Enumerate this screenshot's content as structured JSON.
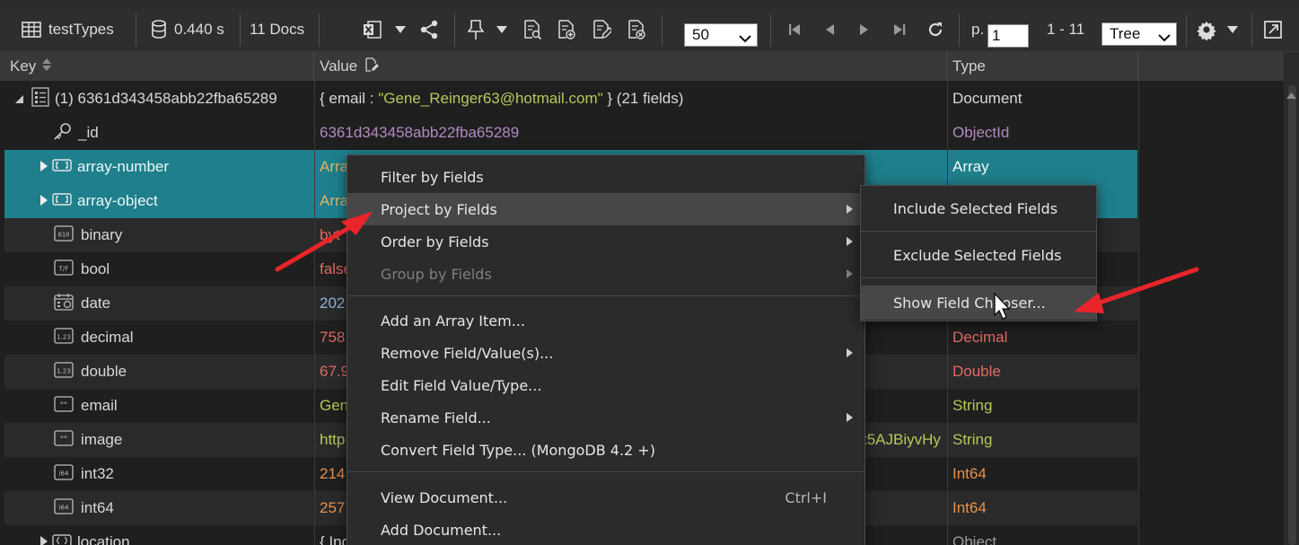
{
  "toolbar": {
    "collection_name": "testTypes",
    "query_time": "0.440 s",
    "doc_count": "11 Docs",
    "page_size": "50",
    "page_label": "p.",
    "page_number": "1",
    "range": "1 - 11",
    "view_mode": "Tree"
  },
  "grid": {
    "columns": [
      "Key",
      "Value",
      "Type"
    ],
    "rows": [
      {
        "key": "(1) 6361d343458abb22fba65289",
        "value_prefix": "{ email : ",
        "value_string": "\"Gene_Reinger63@hotmail.com\"",
        "value_suffix": " } (21 fields)",
        "type": "Document",
        "icon": "document-icon",
        "expander": "expanded"
      },
      {
        "key": "_id",
        "value": "6361d343458abb22fba65289",
        "type": "ObjectId",
        "icon": "key-icon"
      },
      {
        "key": "array-number",
        "value": "Arra",
        "type": "Array",
        "icon": "array-icon",
        "expander": "collapsed",
        "selected": true
      },
      {
        "key": "array-object",
        "value": "Arra",
        "type": "",
        "icon": "array-icon",
        "expander": "collapsed",
        "selected": true
      },
      {
        "key": "binary",
        "value": "byt",
        "type": "",
        "icon": "binary-icon"
      },
      {
        "key": "bool",
        "value": "false",
        "type": "",
        "icon": "bool-icon"
      },
      {
        "key": "date",
        "value": "202",
        "type": "",
        "icon": "calendar-icon"
      },
      {
        "key": "decimal",
        "value": "758",
        "type": "Decimal",
        "icon": "decimal-icon"
      },
      {
        "key": "double",
        "value": "67.9",
        "type": "Double",
        "icon": "double-icon"
      },
      {
        "key": "email",
        "value": "Gen",
        "type": "String",
        "icon": "string-icon"
      },
      {
        "key": "image",
        "value": "http",
        "value_tail": "t5AJBiyvHy",
        "type": "String",
        "icon": "string-icon"
      },
      {
        "key": "int32",
        "value": "214",
        "type": "Int64",
        "icon": "int-icon"
      },
      {
        "key": "int64",
        "value": "257",
        "type": "Int64",
        "icon": "int-icon"
      },
      {
        "key": "location",
        "value": "{ Inc",
        "type": "Object",
        "icon": "object-icon",
        "expander": "collapsed"
      }
    ]
  },
  "context_menu": {
    "items": [
      {
        "label": "Filter by Fields"
      },
      {
        "label": "Project by Fields",
        "submenu": true,
        "highlighted": true
      },
      {
        "label": "Order by Fields",
        "submenu": true
      },
      {
        "label": "Group by Fields",
        "submenu": true,
        "disabled": true
      },
      {
        "label": "Add an Array Item..."
      },
      {
        "label": "Remove Field/Value(s)...",
        "submenu": true
      },
      {
        "label": "Edit Field Value/Type..."
      },
      {
        "label": "Rename Field...",
        "submenu": true
      },
      {
        "label": "Convert Field Type... (MongoDB 4.2 +)"
      },
      {
        "label": "View Document...",
        "shortcut": "Ctrl+I"
      },
      {
        "label": "Add Document..."
      }
    ]
  },
  "submenu": {
    "items": [
      {
        "label": "Include Selected Fields"
      },
      {
        "label": "Exclude Selected Fields"
      },
      {
        "label": "Show Field Chooser...",
        "highlighted": true
      }
    ]
  },
  "colors": {
    "selection": "#1f7f8c",
    "string_value": "#b5c95a",
    "objectid": "#b08ac0",
    "decimal": "#e06a64",
    "int": "#e8914a",
    "annotation_arrow": "#e8252b"
  }
}
